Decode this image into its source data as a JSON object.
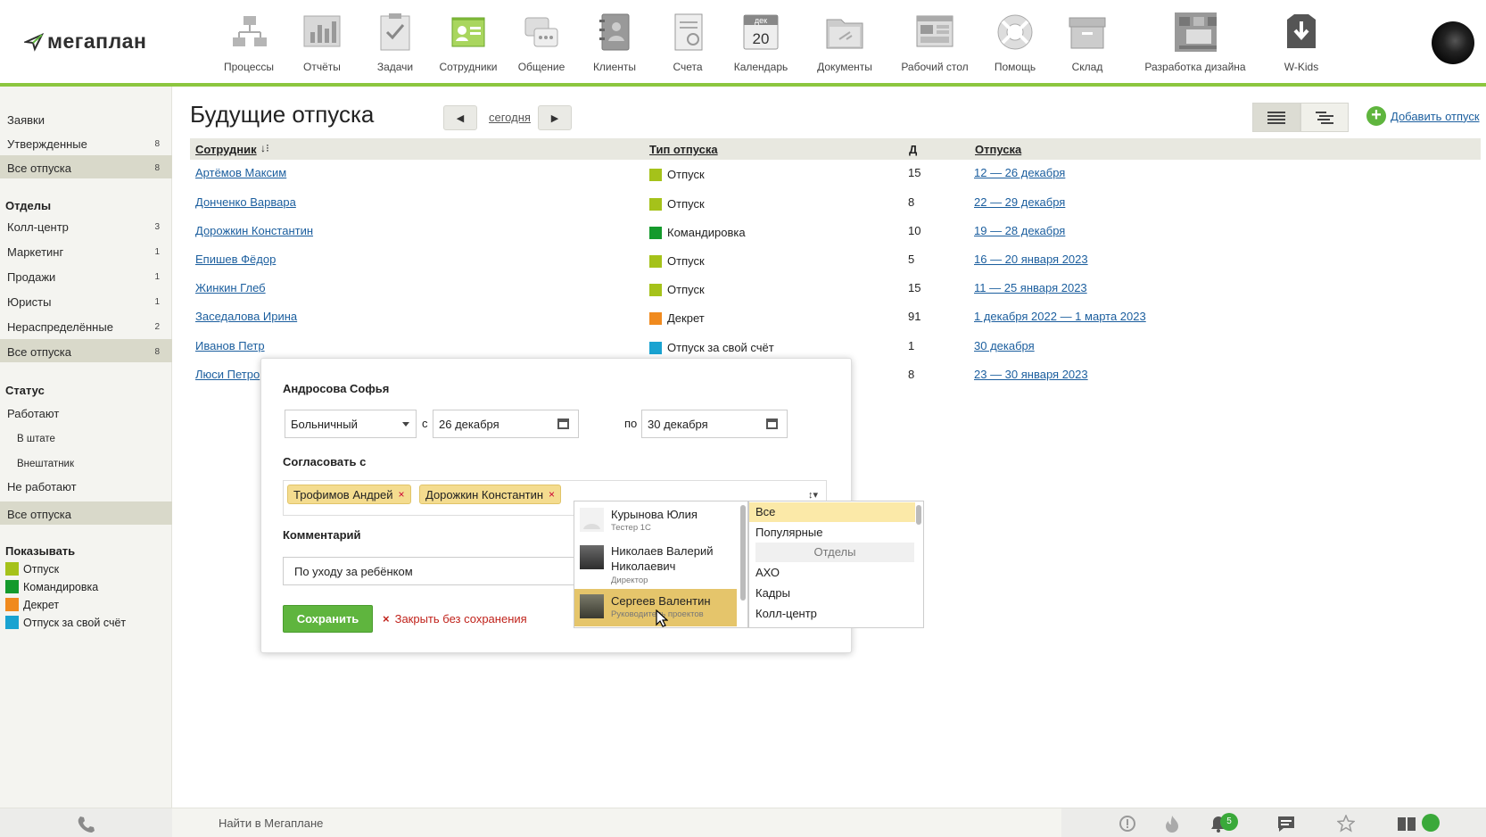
{
  "app": {
    "logo_text": "мегаплан"
  },
  "nav": [
    {
      "label": "Процессы",
      "icon": "processes-icon"
    },
    {
      "label": "Отчёты",
      "icon": "reports-icon"
    },
    {
      "label": "Задачи",
      "icon": "tasks-icon"
    },
    {
      "label": "Сотрудники",
      "icon": "employees-icon",
      "active": true
    },
    {
      "label": "Общение",
      "icon": "chat-icon"
    },
    {
      "label": "Клиенты",
      "icon": "clients-icon"
    },
    {
      "label": "Счета",
      "icon": "invoices-icon"
    },
    {
      "label": "Календарь",
      "icon": "calendar-icon",
      "extra_month": "дек",
      "extra_day": "20"
    },
    {
      "label": "Документы",
      "icon": "documents-icon"
    },
    {
      "label": "Рабочий стол",
      "icon": "desktop-icon"
    },
    {
      "label": "Помощь",
      "icon": "help-icon"
    },
    {
      "label": "Склад",
      "icon": "warehouse-icon"
    },
    {
      "label": "Разработка дизайна",
      "icon": "design-icon"
    },
    {
      "label": "W-Kids",
      "icon": "wkids-icon"
    }
  ],
  "sidebar": {
    "top": [
      {
        "label": "Заявки",
        "count": ""
      },
      {
        "label": "Утвержденные",
        "count": "8"
      },
      {
        "label": "Все отпуска",
        "count": "8",
        "selected": true
      }
    ],
    "departments_title": "Отделы",
    "departments": [
      {
        "label": "Колл-центр",
        "count": "3"
      },
      {
        "label": "Маркетинг",
        "count": "1"
      },
      {
        "label": "Продажи",
        "count": "1"
      },
      {
        "label": "Юристы",
        "count": "1"
      },
      {
        "label": "Нераспределённые",
        "count": "2"
      },
      {
        "label": "Все отпуска",
        "count": "8",
        "selected": true
      }
    ],
    "status_title": "Статус",
    "status": [
      {
        "label": "Работают",
        "indent": false
      },
      {
        "label": "В штате",
        "indent": true
      },
      {
        "label": "Внештатник",
        "indent": true
      },
      {
        "label": "Не работают",
        "indent": false
      },
      {
        "label": "Все отпуска",
        "indent": false,
        "selected": true
      }
    ],
    "show_title": "Показывать",
    "legend": [
      {
        "label": "Отпуск",
        "color": "#a5c21a"
      },
      {
        "label": "Командировка",
        "color": "#149a2c"
      },
      {
        "label": "Декрет",
        "color": "#f08a1e"
      },
      {
        "label": "Отпуск за свой счёт",
        "color": "#1aa3d1"
      }
    ]
  },
  "page": {
    "title": "Будущие отпуска",
    "today": "сегодня",
    "add_label": "Добавить отпуск",
    "columns": {
      "employee": "Сотрудник",
      "type": "Тип отпуска",
      "days": "Д",
      "vacations": "Отпуска"
    },
    "rows": [
      {
        "name": "Артёмов Максим",
        "type": "Отпуск",
        "color": "#a5c21a",
        "days": "15",
        "period": "12 — 26 декабря"
      },
      {
        "name": "Донченко Варвара",
        "type": "Отпуск",
        "color": "#a5c21a",
        "days": "8",
        "period": "22 — 29 декабря"
      },
      {
        "name": "Дорожкин Константин",
        "type": "Командировка",
        "color": "#149a2c",
        "days": "10",
        "period": "19 — 28 декабря"
      },
      {
        "name": "Епишев Фёдор",
        "type": "Отпуск",
        "color": "#a5c21a",
        "days": "5",
        "period": "16 — 20 января 2023"
      },
      {
        "name": "Жинкин Глеб",
        "type": "Отпуск",
        "color": "#a5c21a",
        "days": "15",
        "period": "11 — 25 января 2023"
      },
      {
        "name": "Заседалова Ирина",
        "type": "Декрет",
        "color": "#f08a1e",
        "days": "91",
        "period": "1 декабря 2022 — 1 марта 2023"
      },
      {
        "name": "Иванов Петр",
        "type": "Отпуск за свой счёт",
        "color": "#1aa3d1",
        "days": "1",
        "period": "30 декабря"
      },
      {
        "name": "Люси Петро",
        "type": "",
        "color": "",
        "days": "8",
        "period": "23 — 30 января 2023"
      }
    ]
  },
  "modal": {
    "name": "Андросова Софья",
    "type_value": "Больничный",
    "from_label": "с",
    "from_value": "26 декабря",
    "to_label": "по",
    "to_value": "30 декабря",
    "approve_title": "Согласовать с",
    "tags": [
      "Трофимов Андрей",
      "Дорожкин Константин"
    ],
    "tag_remove": "×",
    "comment_title": "Комментарий",
    "comment_value": "По уходу за ребёнком",
    "save_label": "Сохранить",
    "close_label": "Закрыть без сохранения",
    "close_x": "×"
  },
  "dropdown": {
    "people": [
      {
        "name": "Курынова Юлия",
        "role": "Тестер 1С"
      },
      {
        "name": "Николаев Валерий Николаевич",
        "role": "Директор"
      },
      {
        "name": "Сергеев Валентин",
        "role": "Руководитель проектов",
        "selected": true
      }
    ],
    "groups": [
      {
        "label": "Все",
        "highlight": true
      },
      {
        "label": "Популярные"
      },
      {
        "label": "Отделы",
        "group": true
      },
      {
        "label": "АХО"
      },
      {
        "label": "Кадры"
      },
      {
        "label": "Колл-центр"
      }
    ]
  },
  "bottom": {
    "search_placeholder": "Найти в Мегаплане",
    "notifications_count": "5"
  }
}
